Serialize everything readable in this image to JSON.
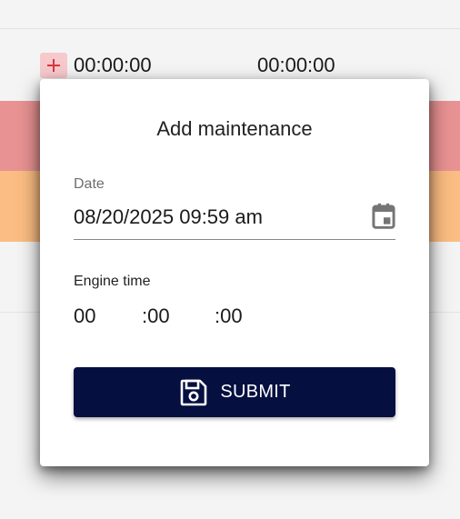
{
  "background_table": {
    "row": {
      "start_time": "00:00:00",
      "end_time": "00:00:00"
    },
    "icons": {
      "add": "plus-icon"
    },
    "colors": {
      "add_button": "#f7c9cc",
      "row_red": "#e99293",
      "row_orange": "#fbbd83"
    }
  },
  "modal": {
    "title": "Add maintenance",
    "date": {
      "label": "Date",
      "value": "08/20/2025 09:59 am",
      "icon": "calendar-icon"
    },
    "engine_time": {
      "label": "Engine time",
      "hours": "00",
      "minutes": ":00",
      "seconds": ":00"
    },
    "submit": {
      "label": "SUBMIT",
      "icon": "save-icon",
      "color": "#050f40"
    }
  }
}
